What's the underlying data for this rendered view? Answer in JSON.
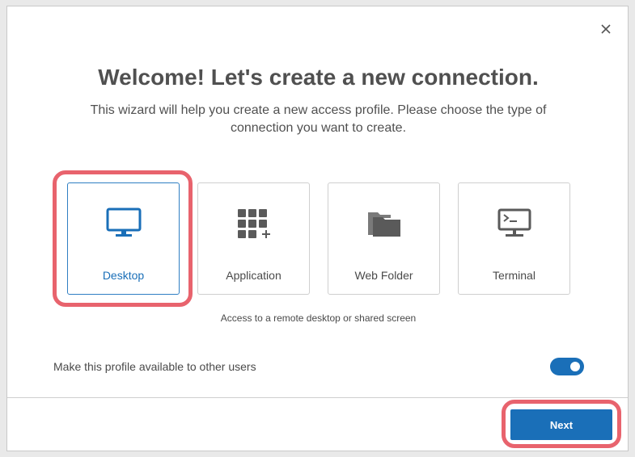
{
  "dialog": {
    "title": "Welcome! Let's create a new connection.",
    "subtitle": "This wizard will help you create a new access profile. Please choose the type of connection you want to create.",
    "close_icon": "close-icon"
  },
  "types": [
    {
      "label": "Desktop",
      "icon": "monitor-icon",
      "selected": true
    },
    {
      "label": "Application",
      "icon": "app-grid-icon",
      "selected": false
    },
    {
      "label": "Web Folder",
      "icon": "folder-icon",
      "selected": false
    },
    {
      "label": "Terminal",
      "icon": "terminal-icon",
      "selected": false
    }
  ],
  "selected_description": "Access to a remote desktop or shared screen",
  "share": {
    "label": "Make this profile available to other users",
    "enabled": true
  },
  "footer": {
    "next_label": "Next"
  },
  "colors": {
    "accent": "#1a6fb8",
    "highlight": "#e8636d",
    "icon_gray": "#5a5a5a",
    "text": "#505050"
  }
}
